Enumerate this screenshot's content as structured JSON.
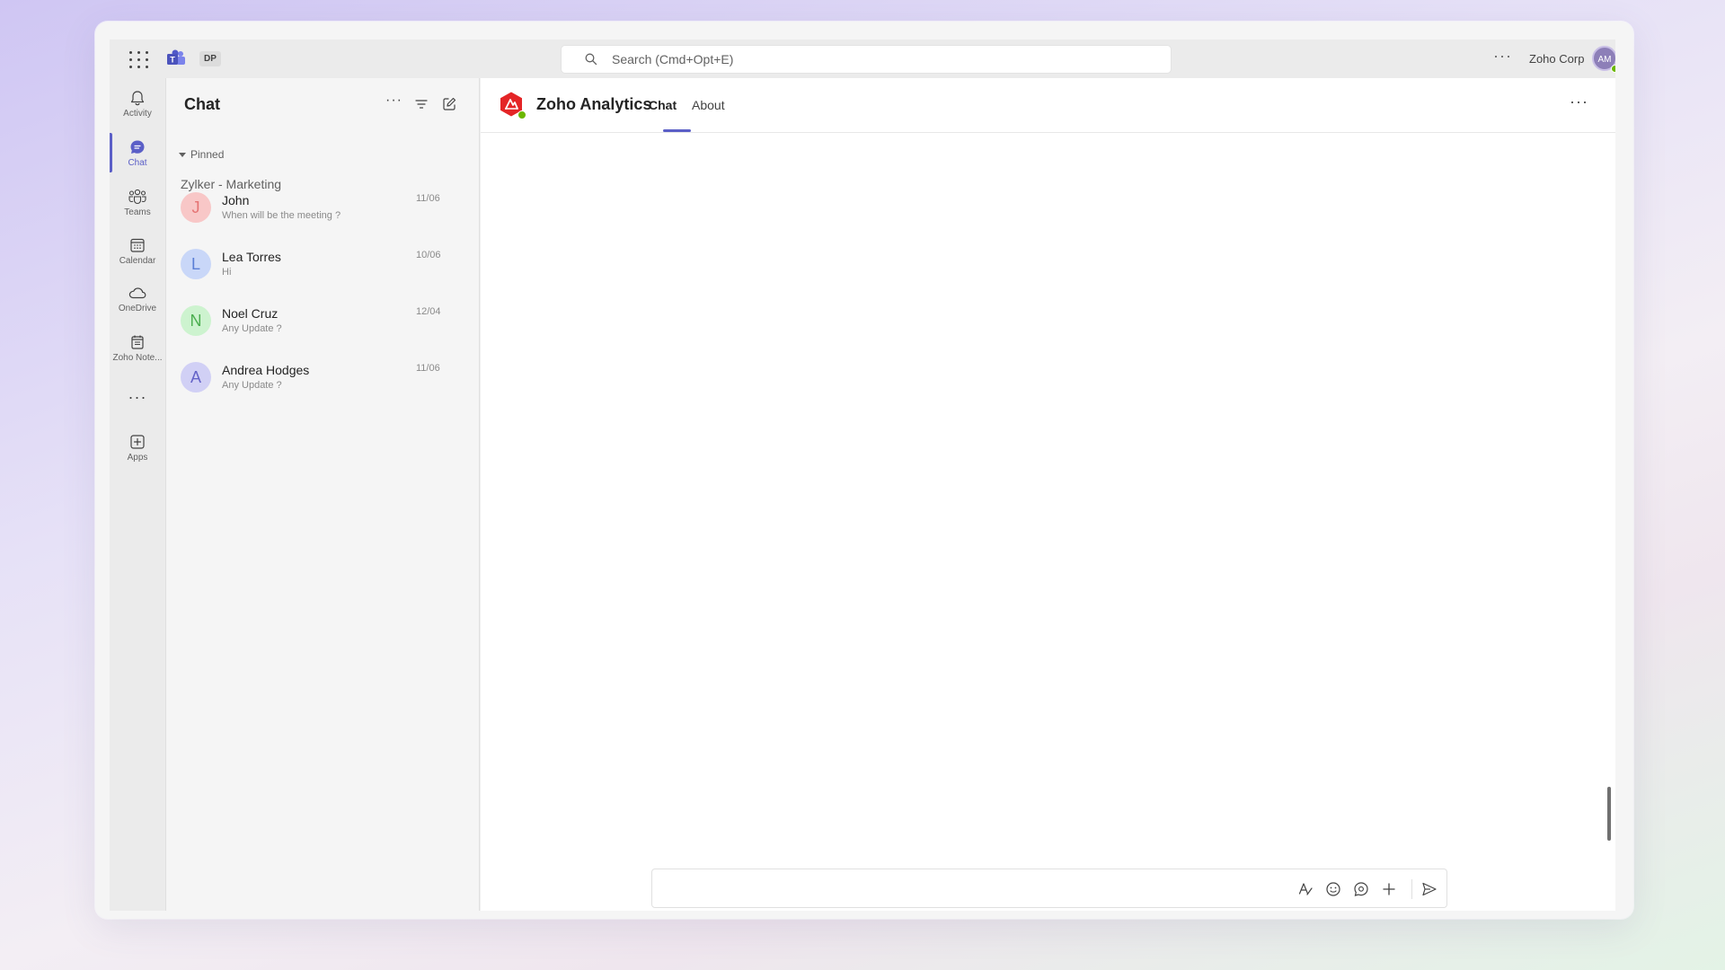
{
  "topbar": {
    "badge": "DP",
    "search_placeholder": "Search (Cmd+Opt+E)",
    "more": "···",
    "org_name": "Zoho Corp",
    "avatar_initials": "AM"
  },
  "rail": {
    "items": [
      {
        "label": "Activity",
        "icon": "bell-icon"
      },
      {
        "label": "Chat",
        "icon": "chat-icon"
      },
      {
        "label": "Teams",
        "icon": "teams-icon"
      },
      {
        "label": "Calendar",
        "icon": "calendar-icon"
      },
      {
        "label": "OneDrive",
        "icon": "cloud-icon"
      },
      {
        "label": "Zoho Note...",
        "icon": "notebook-icon"
      },
      {
        "label": "Apps",
        "icon": "add-apps-icon"
      }
    ],
    "more": "···"
  },
  "chatlist": {
    "title": "Chat",
    "more": "···",
    "pinned_label": "Pinned",
    "group_name": "Zylker - Marketing",
    "chats": [
      {
        "initial": "J",
        "name": "John",
        "preview": "When will be the meeting ?",
        "date": "11/06",
        "color": "#f8c7c7",
        "text_color": "#e57373"
      },
      {
        "initial": "L",
        "name": "Lea Torres",
        "preview": "Hi",
        "date": "10/06",
        "color": "#c9d7f8",
        "text_color": "#5b7fd6"
      },
      {
        "initial": "N",
        "name": "Noel Cruz",
        "preview": "Any Update ?",
        "date": "12/04",
        "color": "#cdf3cf",
        "text_color": "#4caf50"
      },
      {
        "initial": "A",
        "name": "Andrea Hodges",
        "preview": "Any Update ?",
        "date": "11/06",
        "color": "#d1d0f5",
        "text_color": "#6563c8"
      }
    ]
  },
  "main": {
    "app_title": "Zoho Analytics",
    "tabs": [
      {
        "label": "Chat",
        "active": true
      },
      {
        "label": "About",
        "active": false
      }
    ],
    "more": "···",
    "compose_placeholder": ""
  },
  "colors": {
    "accent": "#5b5fc7",
    "presence": "#6bb700",
    "zoho_analytics_red": "#e42527"
  }
}
